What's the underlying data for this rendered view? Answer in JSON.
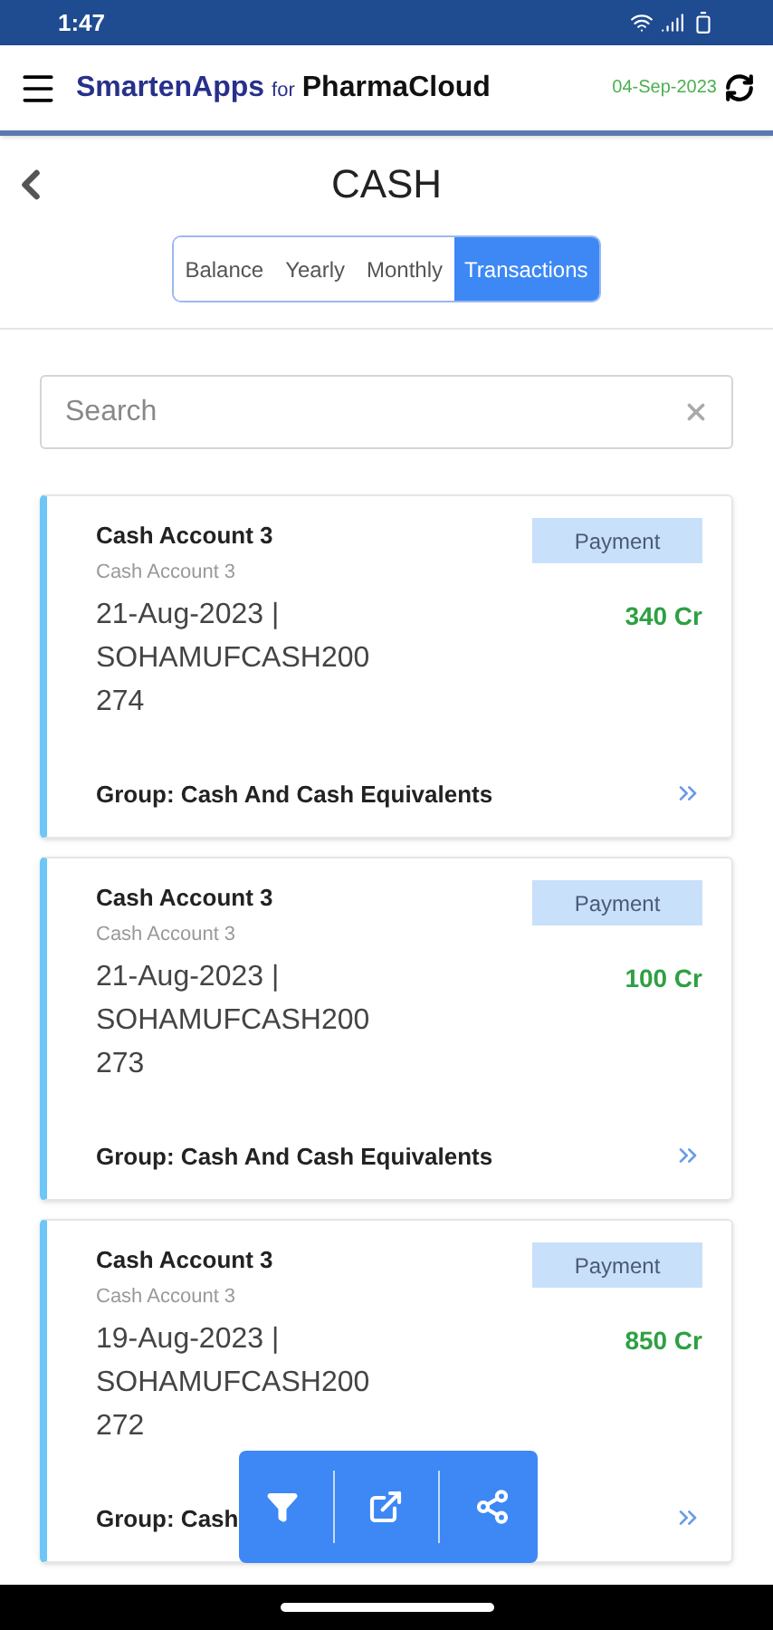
{
  "status_bar": {
    "time": "1:47"
  },
  "header": {
    "brand": "SmartenApps",
    "connector": "for",
    "product": "PharmaCloud",
    "date": "04-Sep-2023"
  },
  "page": {
    "title": "CASH"
  },
  "tabs": [
    {
      "label": "Balance",
      "selected": false
    },
    {
      "label": "Yearly",
      "selected": false
    },
    {
      "label": "Monthly",
      "selected": false
    },
    {
      "label": "Transactions",
      "selected": true
    }
  ],
  "search": {
    "placeholder": "Search"
  },
  "transactions": [
    {
      "account": "Cash Account 3",
      "subtitle": "Cash Account 3",
      "type": "Payment",
      "detail": "21-Aug-2023 | SOHAMUFCASH200 274",
      "amount": "340 Cr",
      "group": "Group: Cash And Cash Equivalents"
    },
    {
      "account": "Cash Account 3",
      "subtitle": "Cash Account 3",
      "type": "Payment",
      "detail": "21-Aug-2023 | SOHAMUFCASH200 273",
      "amount": "100 Cr",
      "group": "Group: Cash And Cash Equivalents"
    },
    {
      "account": "Cash Account 3",
      "subtitle": "Cash Account 3",
      "type": "Payment",
      "detail": "19-Aug-2023 | SOHAMUFCASH200 272",
      "amount": "850 Cr",
      "group": "Group: Cash"
    }
  ]
}
